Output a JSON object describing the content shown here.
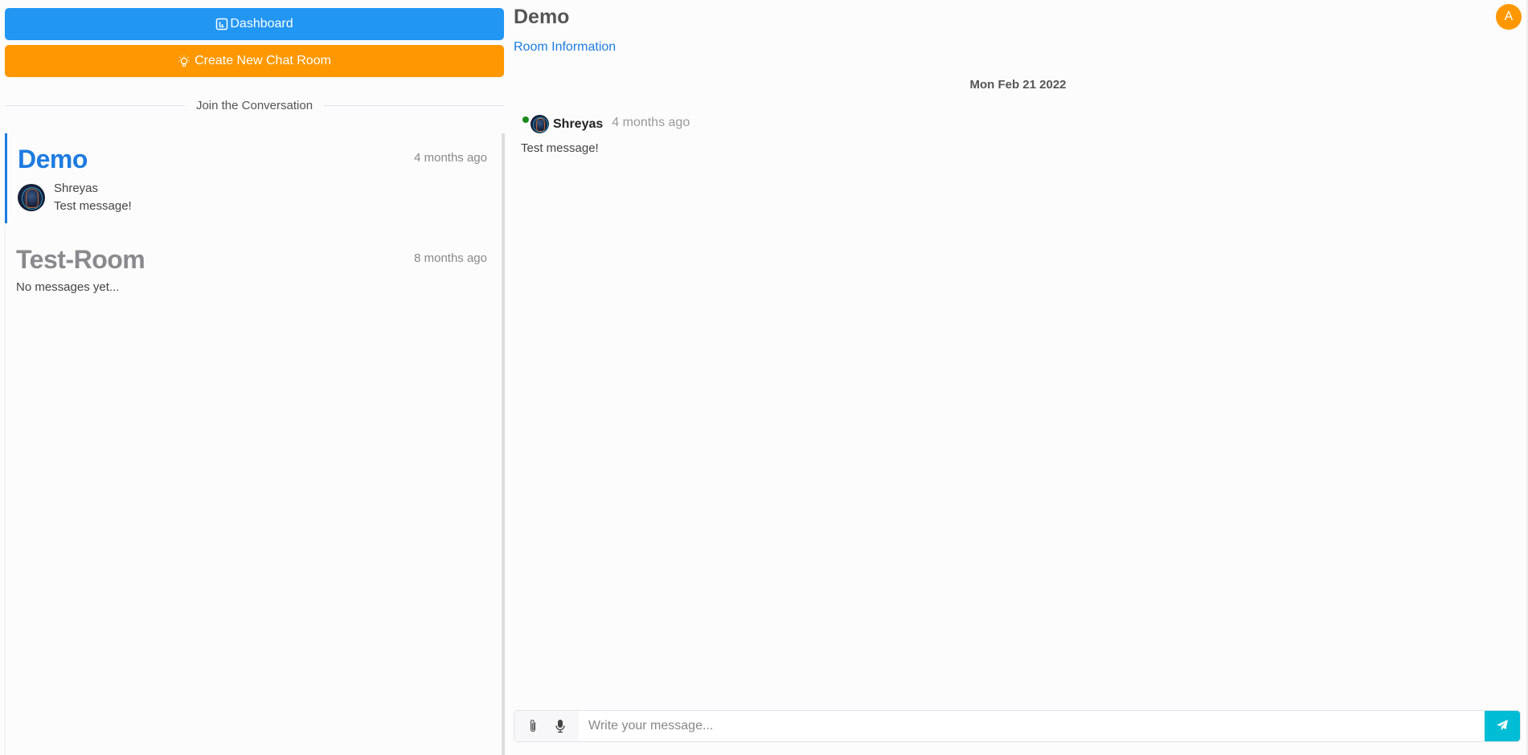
{
  "sidebar": {
    "dashboard_label": "Dashboard",
    "create_room_label": "Create New Chat Room",
    "divider_text": "Join the Conversation",
    "rooms": [
      {
        "name": "Demo",
        "time": "4 months ago",
        "active": true,
        "last_sender": "Shreyas",
        "last_message": "Test message!"
      },
      {
        "name": "Test-Room",
        "time": "8 months ago",
        "active": false,
        "empty_text": "No messages yet..."
      }
    ]
  },
  "chat": {
    "title": "Demo",
    "room_info_label": "Room Information",
    "user_initial": "A",
    "date_separator": "Mon Feb 21 2022",
    "messages": [
      {
        "sender": "Shreyas",
        "time": "4 months ago",
        "text": "Test message!",
        "online": true
      }
    ],
    "composer": {
      "placeholder": "Write your message...",
      "value": ""
    }
  },
  "colors": {
    "primary_blue": "#2196f3",
    "accent_orange": "#ff9800",
    "link_blue": "#1e7be0",
    "send_cyan": "#00bcd4",
    "online_green": "#1a8a1a"
  },
  "icons": {
    "dashboard": "dashboard-icon",
    "create_room": "lightbulb-icon",
    "attach": "paperclip-icon",
    "mic": "microphone-icon",
    "send": "paper-plane-icon"
  }
}
